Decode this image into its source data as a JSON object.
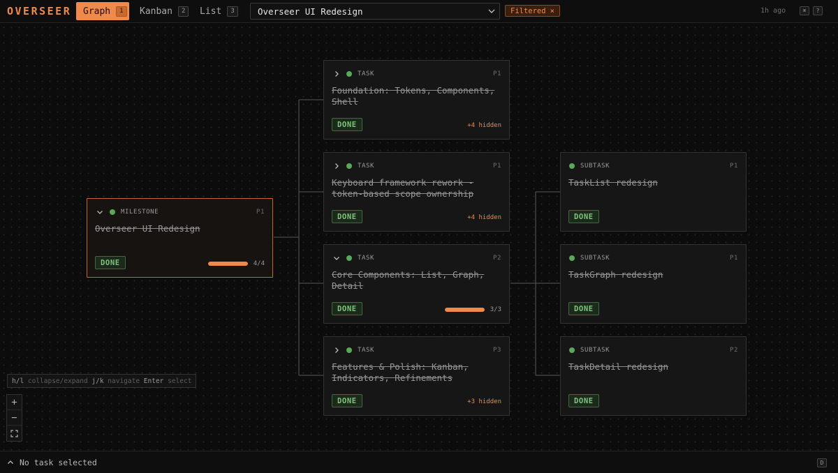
{
  "app": {
    "logo": "OVERSEER"
  },
  "tabs": [
    {
      "label": "Graph",
      "key": "1",
      "active": true
    },
    {
      "label": "Kanban",
      "key": "2",
      "active": false
    },
    {
      "label": "List",
      "key": "3",
      "active": false
    }
  ],
  "project_select": {
    "value": "Overseer UI Redesign"
  },
  "filter": {
    "label": "Filtered",
    "clear_icon": "×"
  },
  "header_right": {
    "timestamp": "1h ago",
    "keys": [
      "⌘",
      "?"
    ]
  },
  "nodes": {
    "milestone": {
      "type": "MILESTONE",
      "priority": "P1",
      "title": "Overseer UI Redesign",
      "status": "DONE",
      "progress_label": "4/4",
      "progress": 1.0,
      "expanded": true
    },
    "task1": {
      "type": "TASK",
      "priority": "P1",
      "title": "Foundation: Tokens, Components, Shell",
      "status": "DONE",
      "hidden": "+4 hidden",
      "expanded": false
    },
    "task2": {
      "type": "TASK",
      "priority": "P1",
      "title": "Keyboard framework rework - token-based scope ownership",
      "status": "DONE",
      "hidden": "+4 hidden",
      "expanded": false
    },
    "task3": {
      "type": "TASK",
      "priority": "P2",
      "title": "Core Components: List, Graph, Detail",
      "status": "DONE",
      "progress_label": "3/3",
      "progress": 1.0,
      "expanded": true
    },
    "task4": {
      "type": "TASK",
      "priority": "P3",
      "title": "Features & Polish: Kanban, Indicators, Refinements",
      "status": "DONE",
      "hidden": "+3 hidden",
      "expanded": false
    },
    "sub1": {
      "type": "SUBTASK",
      "priority": "P1",
      "title": "TaskList redesign",
      "status": "DONE"
    },
    "sub2": {
      "type": "SUBTASK",
      "priority": "P1",
      "title": "TaskGraph redesign",
      "status": "DONE"
    },
    "sub3": {
      "type": "SUBTASK",
      "priority": "P2",
      "title": "TaskDetail redesign",
      "status": "DONE"
    }
  },
  "hint": {
    "k1": "h/l",
    "t1": " collapse/expand ",
    "k2": "j/k",
    "t2": " navigate ",
    "k3": "Enter",
    "t3": " select"
  },
  "zoom": {
    "in": "+",
    "out": "−",
    "fit": "⛶"
  },
  "bottom": {
    "status": "No task selected",
    "key": "D"
  },
  "colors": {
    "accent": "#f08a4b",
    "done_green": "#7fc27f",
    "status_dot": "#5aa85a"
  }
}
